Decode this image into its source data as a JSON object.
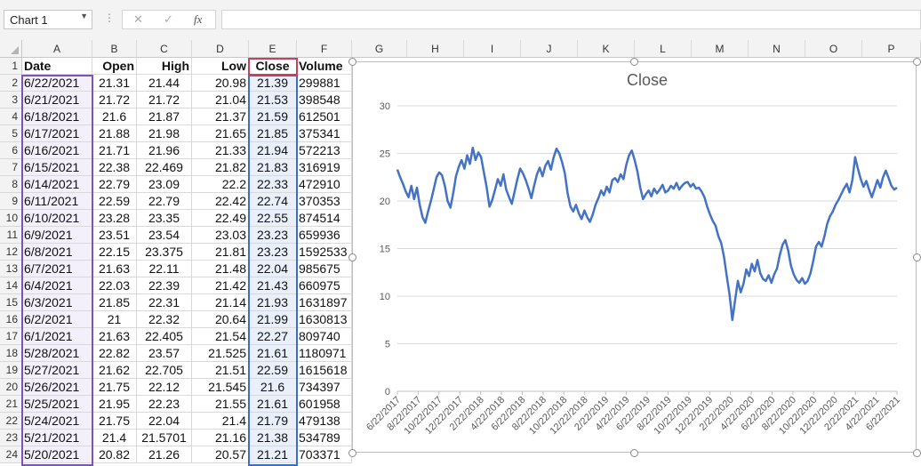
{
  "name_box": {
    "value": "Chart 1"
  },
  "formula_bar": {
    "dots": "⋮",
    "cancel_icon": "✕",
    "enter_icon": "✓",
    "function_icon": "fx",
    "content": ""
  },
  "columns": [
    "A",
    "B",
    "C",
    "D",
    "E",
    "F",
    "G",
    "H",
    "I",
    "J",
    "K",
    "L",
    "M",
    "N",
    "O",
    "P"
  ],
  "rows": [
    "1",
    "2",
    "3",
    "4",
    "5",
    "6",
    "7",
    "8",
    "9",
    "10",
    "11",
    "12",
    "13",
    "14",
    "15",
    "16",
    "17",
    "18",
    "19",
    "20",
    "21",
    "22",
    "23",
    "24"
  ],
  "table": {
    "headers": [
      "Date",
      "Open",
      "High",
      "Low",
      "Close",
      "Volume"
    ],
    "rows": [
      [
        "6/22/2021",
        "21.31",
        "21.44",
        "20.98",
        "21.39",
        "299881"
      ],
      [
        "6/21/2021",
        "21.72",
        "21.72",
        "21.04",
        "21.53",
        "398548"
      ],
      [
        "6/18/2021",
        "21.6",
        "21.87",
        "21.37",
        "21.59",
        "612501"
      ],
      [
        "6/17/2021",
        "21.88",
        "21.98",
        "21.65",
        "21.85",
        "375341"
      ],
      [
        "6/16/2021",
        "21.71",
        "21.96",
        "21.33",
        "21.94",
        "572213"
      ],
      [
        "6/15/2021",
        "22.38",
        "22.469",
        "21.82",
        "21.83",
        "316919"
      ],
      [
        "6/14/2021",
        "22.79",
        "23.09",
        "22.2",
        "22.33",
        "472910"
      ],
      [
        "6/11/2021",
        "22.59",
        "22.79",
        "22.42",
        "22.74",
        "370353"
      ],
      [
        "6/10/2021",
        "23.28",
        "23.35",
        "22.49",
        "22.55",
        "874514"
      ],
      [
        "6/9/2021",
        "23.51",
        "23.54",
        "23.03",
        "23.23",
        "659936"
      ],
      [
        "6/8/2021",
        "22.15",
        "23.375",
        "21.81",
        "23.23",
        "1592533"
      ],
      [
        "6/7/2021",
        "21.63",
        "22.11",
        "21.48",
        "22.04",
        "985675"
      ],
      [
        "6/4/2021",
        "22.03",
        "22.39",
        "21.42",
        "21.43",
        "660975"
      ],
      [
        "6/3/2021",
        "21.85",
        "22.31",
        "21.14",
        "21.93",
        "1631897"
      ],
      [
        "6/2/2021",
        "21",
        "22.32",
        "20.64",
        "21.99",
        "1630813"
      ],
      [
        "6/1/2021",
        "21.63",
        "22.405",
        "21.54",
        "22.27",
        "809740"
      ],
      [
        "5/28/2021",
        "22.82",
        "23.57",
        "21.525",
        "21.61",
        "1180971"
      ],
      [
        "5/27/2021",
        "21.62",
        "22.705",
        "21.51",
        "22.59",
        "1615618"
      ],
      [
        "5/26/2021",
        "21.75",
        "22.12",
        "21.545",
        "21.6",
        "734397"
      ],
      [
        "5/25/2021",
        "21.95",
        "22.23",
        "21.55",
        "21.61",
        "601958"
      ],
      [
        "5/24/2021",
        "21.75",
        "22.04",
        "21.4",
        "21.79",
        "479138"
      ],
      [
        "5/21/2021",
        "21.4",
        "21.5701",
        "21.16",
        "21.38",
        "534789"
      ],
      [
        "5/20/2021",
        "20.82",
        "21.26",
        "20.57",
        "21.21",
        "703371"
      ]
    ]
  },
  "colors": {
    "line": "#4472c4",
    "grid": "#d9d9d9",
    "axis_text": "#595959",
    "title": "#595959"
  },
  "chart_data": {
    "type": "line",
    "title": "Close",
    "series": [
      {
        "values": [
          23.3,
          22.5,
          21.8,
          21.0,
          20.4,
          21.6,
          20.2,
          21.4,
          19.6,
          18.3,
          17.7,
          18.9,
          20.0,
          21.2,
          22.5,
          23.0,
          22.7,
          21.6,
          20.0,
          19.3,
          20.8,
          22.6,
          23.6,
          24.3,
          23.4,
          24.8,
          23.9,
          25.6,
          24.3,
          25.1,
          24.6,
          23.0,
          21.4,
          19.4,
          20.1,
          21.2,
          22.3,
          21.6,
          22.8,
          21.2,
          20.4,
          19.7,
          21.0,
          22.3,
          23.4,
          22.9,
          22.2,
          21.3,
          20.3,
          21.6,
          22.8,
          23.5,
          22.6,
          23.7,
          24.2,
          23.3,
          24.6,
          25.5,
          25.0,
          24.1,
          22.9,
          20.8,
          19.4,
          18.9,
          19.6,
          18.7,
          18.1,
          19.0,
          18.3,
          17.8,
          18.6,
          19.6,
          20.3,
          21.1,
          20.6,
          21.5,
          20.9,
          22.2,
          22.4,
          22.0,
          22.8,
          22.3,
          23.8,
          24.8,
          25.3,
          24.3,
          23.1,
          21.4,
          20.2,
          20.7,
          21.1,
          20.5,
          21.3,
          20.8,
          21.2,
          21.7,
          20.9,
          21.1,
          21.6,
          21.3,
          21.9,
          21.2,
          21.6,
          21.9,
          22.0,
          21.5,
          21.8,
          21.3,
          21.4,
          21.0,
          20.4,
          19.4,
          18.6,
          17.9,
          17.4,
          16.3,
          15.6,
          14.2,
          12.1,
          10.2,
          7.5,
          9.6,
          11.6,
          10.4,
          11.3,
          12.8,
          12.1,
          13.4,
          12.6,
          13.8,
          12.4,
          11.8,
          11.6,
          12.2,
          11.4,
          12.3,
          12.9,
          14.3,
          15.4,
          15.9,
          14.8,
          13.2,
          12.3,
          11.7,
          11.4,
          11.9,
          11.3,
          11.6,
          12.4,
          13.7,
          15.2,
          15.7,
          15.2,
          16.3,
          17.6,
          18.4,
          18.9,
          19.6,
          20.1,
          20.7,
          21.3,
          21.8,
          20.9,
          22.2,
          24.6,
          23.4,
          22.3,
          21.5,
          22.1,
          21.2,
          20.4,
          21.3,
          22.2,
          21.4,
          22.5,
          23.2,
          22.4,
          21.6,
          21.2,
          21.4
        ]
      }
    ],
    "x_tick_labels": [
      "6/22/2017",
      "8/22/2017",
      "10/22/2017",
      "12/22/2017",
      "2/22/2018",
      "4/22/2018",
      "6/22/2018",
      "8/22/2018",
      "10/22/2018",
      "12/22/2018",
      "2/22/2019",
      "4/22/2019",
      "6/22/2019",
      "8/22/2019",
      "10/22/2019",
      "12/22/2019",
      "2/22/2020",
      "4/22/2020",
      "6/22/2020",
      "8/22/2020",
      "10/22/2020",
      "12/22/2020",
      "2/22/2021",
      "4/22/2021",
      "6/22/2021"
    ],
    "y_ticks": [
      "0",
      "5",
      "10",
      "15",
      "20",
      "25",
      "30"
    ],
    "ylim": [
      0,
      30
    ],
    "grid": true,
    "legend": "none"
  }
}
